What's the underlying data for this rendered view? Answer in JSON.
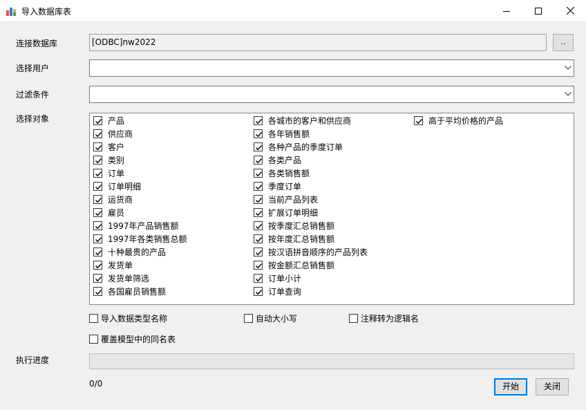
{
  "window": {
    "title": "导入数据库表",
    "icon": "app-icon"
  },
  "form": {
    "connection_label": "连接数据库",
    "connection_value": "[ODBC]nw2022",
    "browse_label": "..",
    "user_label": "选择用户",
    "user_value": "",
    "filter_label": "过滤条件",
    "filter_value": "",
    "objects_label": "选择对象",
    "progress_label": "执行进度",
    "progress_value": 0,
    "count_text": "0/0"
  },
  "objects": {
    "col1": [
      {
        "label": "产品",
        "checked": true
      },
      {
        "label": "供应商",
        "checked": true
      },
      {
        "label": "客户",
        "checked": true
      },
      {
        "label": "类别",
        "checked": true
      },
      {
        "label": "订单",
        "checked": true
      },
      {
        "label": "订单明细",
        "checked": true
      },
      {
        "label": "运货商",
        "checked": true
      },
      {
        "label": "雇员",
        "checked": true
      },
      {
        "label": "1997年产品销售额",
        "checked": true
      },
      {
        "label": "1997年各类销售总额",
        "checked": true
      },
      {
        "label": "十种最贵的产品",
        "checked": true
      },
      {
        "label": "发货单",
        "checked": true
      },
      {
        "label": "发货单筛选",
        "checked": true
      },
      {
        "label": "各国雇员销售额",
        "checked": true
      }
    ],
    "col2": [
      {
        "label": "各城市的客户和供应商",
        "checked": true
      },
      {
        "label": "各年销售额",
        "checked": true
      },
      {
        "label": "各种产品的季度订单",
        "checked": true
      },
      {
        "label": "各类产品",
        "checked": true
      },
      {
        "label": "各类销售额",
        "checked": true
      },
      {
        "label": "季度订单",
        "checked": true
      },
      {
        "label": "当前产品列表",
        "checked": true
      },
      {
        "label": "扩展订单明细",
        "checked": true
      },
      {
        "label": "按季度汇总销售额",
        "checked": true
      },
      {
        "label": "按年度汇总销售额",
        "checked": true
      },
      {
        "label": "按汉语拼音顺序的产品列表",
        "checked": true
      },
      {
        "label": "按金额汇总销售额",
        "checked": true
      },
      {
        "label": "订单小计",
        "checked": true
      },
      {
        "label": "订单查询",
        "checked": true
      }
    ],
    "col3": [
      {
        "label": "高于平均价格的产品",
        "checked": true
      }
    ]
  },
  "options": {
    "import_type_names": {
      "label": "导入数据类型名称",
      "checked": false
    },
    "auto_case": {
      "label": "自动大小写",
      "checked": false
    },
    "comment_to_logical": {
      "label": "注释转为逻辑名",
      "checked": false
    },
    "overwrite_same_name": {
      "label": "覆盖模型中的同名表",
      "checked": false
    }
  },
  "buttons": {
    "start": "开始",
    "close": "关闭"
  },
  "colors": {
    "accent": "#0078d7",
    "progress": "#06b025"
  }
}
